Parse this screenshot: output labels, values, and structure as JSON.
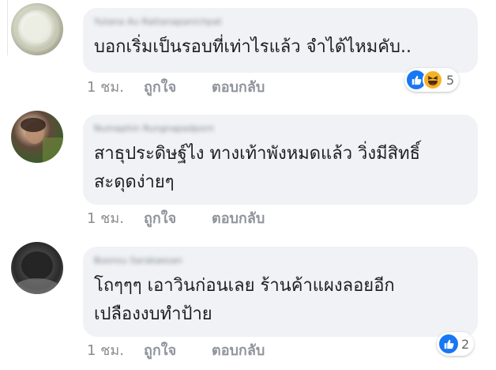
{
  "comments": [
    {
      "author": "Yutana Au Rattanapanichpat",
      "text": "บอกเริ่มเป็นรอบที่เท่าไรแล้ว จำได้ไหมคับ..",
      "time": "1 ชม.",
      "like_label": "ถูกใจ",
      "reply_label": "ตอบกลับ",
      "reaction_icons": [
        "like-icon",
        "haha-icon"
      ],
      "reaction_count": "5"
    },
    {
      "author": "Numaphin Rungnapadporn",
      "text": "สาธุประดิษฐ์ไง ทางเท้าพังหมดแล้ว วิ่งมีสิทธิ์\nสะดุดง่ายๆ",
      "time": "1 ชม.",
      "like_label": "ถูกใจ",
      "reply_label": "ตอบกลับ"
    },
    {
      "author": "Boonsu Sarakaesan",
      "text": "โถๆๆๆ เอาวินก่อนเลย ร้านค้าแผงลอยอีก\nเปลืองงบทำป้าย",
      "time": "1 ชม.",
      "like_label": "ถูกใจ",
      "reply_label": "ตอบกลับ",
      "reaction_icons": [
        "like-icon"
      ],
      "reaction_count": "2"
    }
  ],
  "colors": {
    "bubble": "#f0f2f5",
    "like_blue": "#1877f2",
    "haha_yellow": "#f7b125",
    "meta_gray": "#8a8d91"
  }
}
